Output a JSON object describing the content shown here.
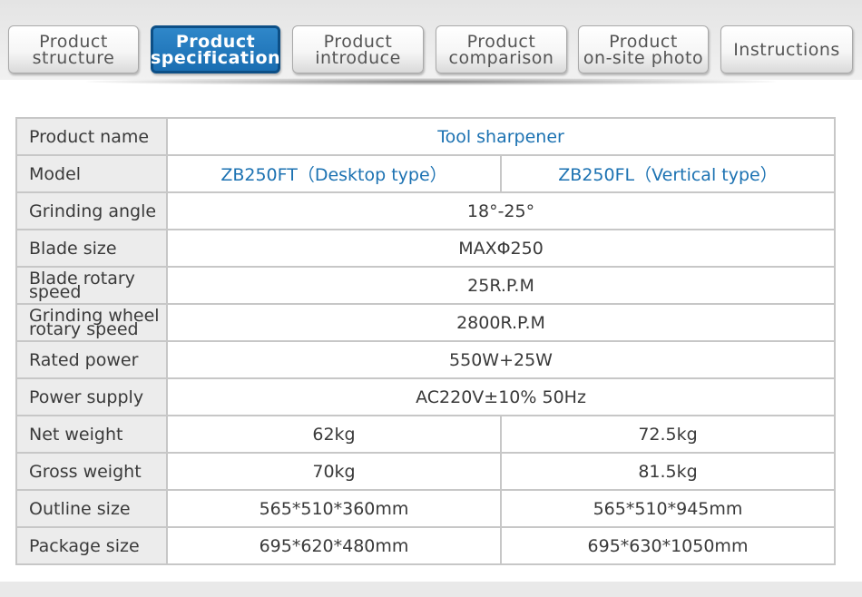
{
  "tabs": [
    {
      "line1": "Product",
      "line2": "structure",
      "active": false
    },
    {
      "line1": "Product",
      "line2": "specification",
      "active": true
    },
    {
      "line1": "Product",
      "line2": "introduce",
      "active": false
    },
    {
      "line1": "Product",
      "line2": "comparison",
      "active": false
    },
    {
      "line1": "Product",
      "line2": "on-site photo",
      "active": false
    },
    {
      "line1": "Instructions",
      "line2": "",
      "active": false
    }
  ],
  "spec": {
    "product_name_label": "Product name",
    "product_name_value": "Tool sharpener",
    "model_label": "Model",
    "model_a": "ZB250FT（Desktop type）",
    "model_b": "ZB250FL（Vertical type）",
    "grinding_angle_label": "Grinding angle",
    "grinding_angle_value": "18°-25°",
    "blade_size_label": "Blade size",
    "blade_size_value": "MAXΦ250",
    "blade_rotary_label_1": "Blade rotary",
    "blade_rotary_label_2": "speed",
    "blade_rotary_value": "25R.P.M",
    "wheel_rotary_label_1": "Grinding wheel",
    "wheel_rotary_label_2": "rotary speed",
    "wheel_rotary_value": "2800R.P.M",
    "rated_power_label": "Rated power",
    "rated_power_value": "550W+25W",
    "power_supply_label": "Power supply",
    "power_supply_value": "AC220V±10% 50Hz",
    "net_weight_label": "Net weight",
    "net_weight_a": "62kg",
    "net_weight_b": "72.5kg",
    "gross_weight_label": "Gross weight",
    "gross_weight_a": "70kg",
    "gross_weight_b": "81.5kg",
    "outline_size_label": "Outline size",
    "outline_size_a": "565*510*360mm",
    "outline_size_b": "565*510*945mm",
    "package_size_label": "Package size",
    "package_size_a": "695*620*480mm",
    "package_size_b": "695*630*1050mm"
  },
  "colors": {
    "accent_blue": "#1c72b2",
    "active_tab": "#1a6eb2",
    "label_bg": "#ececec",
    "border": "#c7c7c7"
  }
}
